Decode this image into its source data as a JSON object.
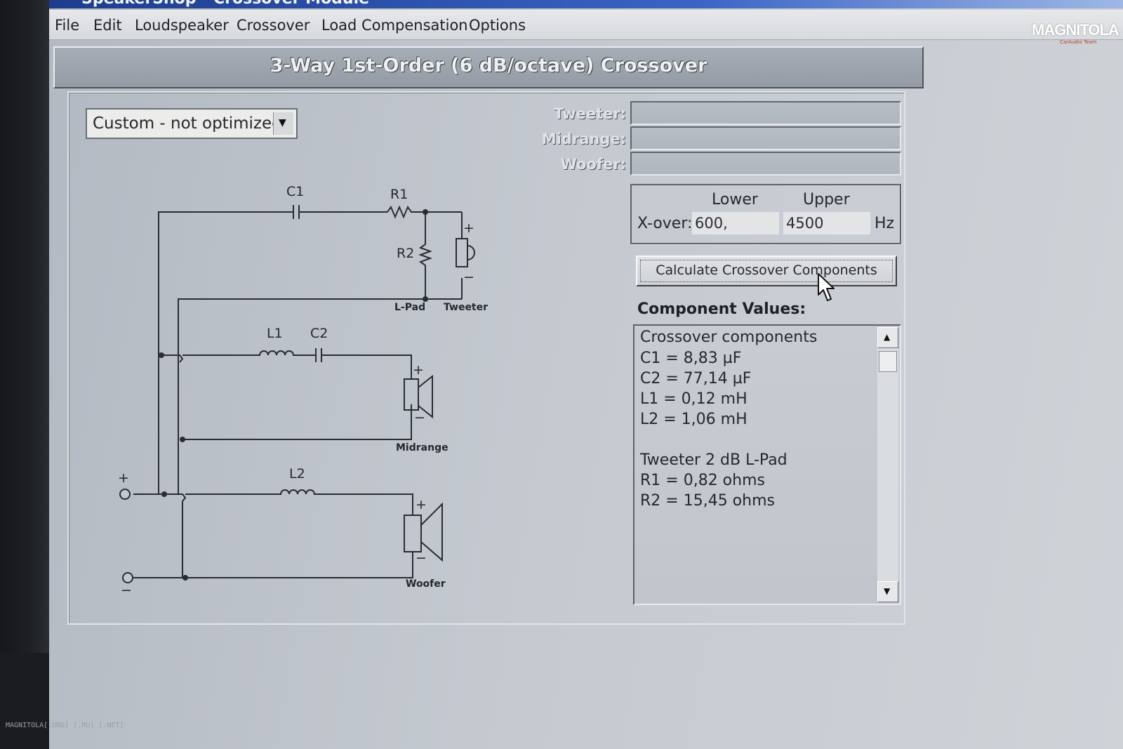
{
  "window": {
    "title": "SpeakerShop - Crossover Module"
  },
  "brand": {
    "logo": "MAGNITOLA",
    "logo_sub": "CarAudio Team"
  },
  "menu": [
    "File",
    "Edit",
    "Loudspeaker",
    "Crossover",
    "Load Compensation",
    "Options"
  ],
  "header": {
    "title": "3-Way 1st-Order (6 dB/octave) Crossover"
  },
  "preset": {
    "selected": "Custom - not optimized"
  },
  "drivers": {
    "tweeter_label": "Tweeter:",
    "midrange_label": "Midrange:",
    "woofer_label": "Woofer:"
  },
  "xover": {
    "lower_label": "Lower",
    "upper_label": "Upper",
    "row_label": "X-over:",
    "lower_value": "600,",
    "upper_value": "4500",
    "unit": "Hz"
  },
  "calculate_button": "Calculate Crossover Components",
  "component_values": {
    "title": "Component Values:",
    "lines": [
      "Crossover components",
      "C1 =  8,83 µF",
      "C2 =  77,14 µF",
      "L1 =  0,12 mH",
      "L2 =  1,06 mH",
      "",
      "Tweeter 2 dB L-Pad",
      "R1 =  0,82 ohms",
      "R2 =  15,45 ohms"
    ]
  },
  "schematic": {
    "labels": {
      "c1": "C1",
      "r1": "R1",
      "r2": "R2",
      "l1": "L1",
      "c2": "C2",
      "l2": "L2",
      "lpad": "L-Pad",
      "tweeter": "Tweeter",
      "midrange": "Midrange",
      "woofer": "Woofer",
      "plus": "+",
      "minus": "−"
    }
  },
  "footer": {
    "watermark": "MAGNITOLA[.ORG] [.RU] [.NET]"
  },
  "colors": {
    "screen": "#c4c9d0",
    "title_bar": "#3a63c4",
    "text": "#25272b"
  }
}
